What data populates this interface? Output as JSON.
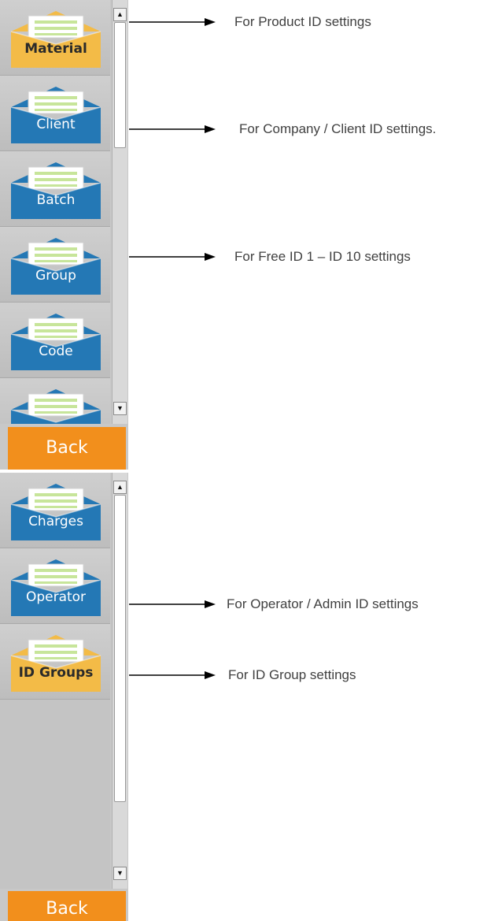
{
  "top_panel": {
    "items": [
      {
        "label": "Material",
        "icon": "envelope-open-yellow-icon",
        "color": "#f3bb47"
      },
      {
        "label": "Client",
        "icon": "envelope-open-blue-icon",
        "color": "#2478b5"
      },
      {
        "label": "Batch",
        "icon": "envelope-open-blue-icon",
        "color": "#2478b5"
      },
      {
        "label": "Group",
        "icon": "envelope-open-blue-icon",
        "color": "#2478b5"
      },
      {
        "label": "Code",
        "icon": "envelope-open-blue-icon",
        "color": "#2478b5"
      },
      {
        "label": "",
        "icon": "envelope-open-blue-icon",
        "color": "#2478b5"
      }
    ],
    "back_label": "Back"
  },
  "bottom_panel": {
    "items": [
      {
        "label": "Charges",
        "icon": "envelope-open-blue-icon",
        "color": "#2478b5"
      },
      {
        "label": "Operator",
        "icon": "envelope-open-blue-icon",
        "color": "#2478b5"
      },
      {
        "label": "ID Groups",
        "icon": "envelope-open-yellow-icon",
        "color": "#f3bb47"
      }
    ],
    "back_label": "Back"
  },
  "annotations": [
    {
      "text": "For Product ID settings"
    },
    {
      "text": "For Company / Client ID settings."
    },
    {
      "text": "For Free ID 1 – ID 10 settings"
    },
    {
      "text": "For Operator / Admin ID settings"
    },
    {
      "text": "For ID Group settings"
    }
  ],
  "colors": {
    "accent_orange": "#f28f1c",
    "envelope_blue": "#2478b5",
    "envelope_yellow": "#f3bb47",
    "paper_green": "#c7e59a"
  }
}
